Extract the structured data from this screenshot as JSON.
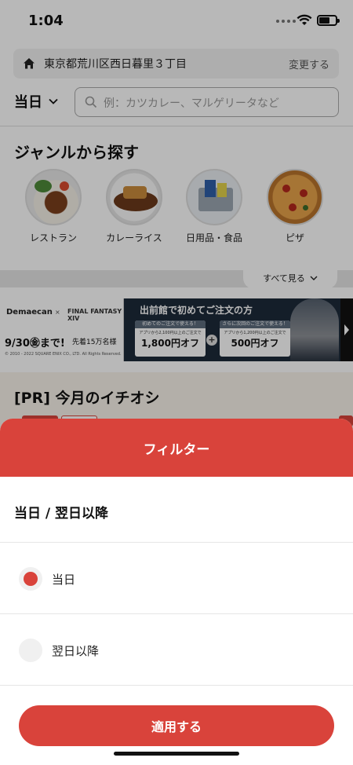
{
  "status_bar": {
    "time": "1:04"
  },
  "address": {
    "text": "東京都荒川区西日暮里３丁目",
    "change_label": "変更する"
  },
  "date_select": {
    "label": "当日"
  },
  "search": {
    "placeholder": "例：カツカレー、マルゲリータなど"
  },
  "genres": {
    "title": "ジャンルから探す",
    "items": [
      {
        "label": "レストラン"
      },
      {
        "label": "カレーライス"
      },
      {
        "label": "日用品・食品"
      },
      {
        "label": "ピザ"
      }
    ],
    "see_all": "すべて見る"
  },
  "banner": {
    "brand": "Demaecan",
    "x": "×",
    "collab": "FINAL FANTASY XIV",
    "until": "9/30㊎まで!",
    "first_come": "先着15万名様",
    "copyright": "© 2010 - 2022 SQUARE ENIX CO., LTD. All Rights Reserved.",
    "headline": "出前館で初めてご注文の方",
    "offer1": {
      "head": "初めてのご注文で使える！",
      "sub": "アプリから2,100円以上のご注文で",
      "value": "1,800円オフ"
    },
    "offer2": {
      "head": "さらに次回のご注文で使える！",
      "sub": "アプリから1,200円以上のご注文で",
      "value": "500円オフ"
    },
    "plus": "+"
  },
  "pr": {
    "title": "[PR] 今月のイチオシ"
  },
  "filter_sheet": {
    "title": "フィルター",
    "section_title": "当日 / 翌日以降",
    "options": [
      {
        "label": "当日",
        "selected": true
      },
      {
        "label": "翌日以降",
        "selected": false
      }
    ],
    "apply_label": "適用する"
  },
  "colors": {
    "accent": "#d9433b"
  }
}
